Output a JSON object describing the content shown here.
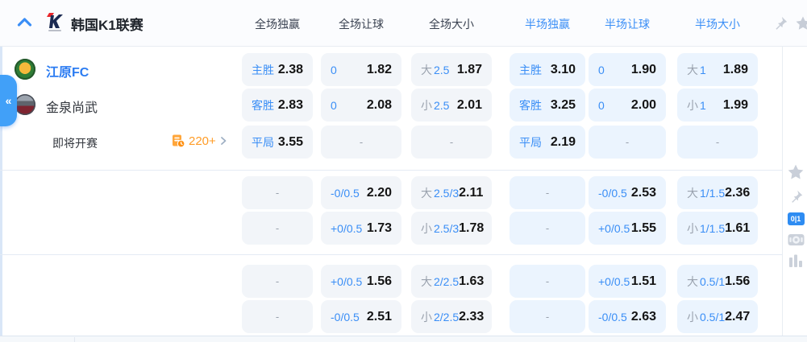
{
  "header": {
    "league_name": "韩国K1联赛",
    "columns": [
      "全场独赢",
      "全场让球",
      "全场大小",
      "半场独赢",
      "半场让球",
      "半场大小"
    ]
  },
  "teams": [
    {
      "name": "江原FC"
    },
    {
      "name": "金泉尚武"
    }
  ],
  "status": {
    "label": "即将开赛",
    "more_count": "220+"
  },
  "side_tab": {
    "glyph": "«"
  },
  "rail": {
    "score": "0|1"
  },
  "colors": {
    "accent_blue": "#3A8EF6",
    "team_blue": "#2B7CF2",
    "odds_black": "#141414",
    "muted_grey": "#9AA2AE",
    "orange": "#FF9C27",
    "cell_full_bg": "#F2F5F9",
    "cell_half_bg": "#EBF4FE"
  },
  "rows": [
    {
      "cells": [
        {
          "b": "主胜",
          "o": "2.38"
        },
        {
          "b": "0",
          "o": "1.82"
        },
        {
          "g": "大",
          "b": "2.5",
          "o": "1.87"
        },
        {
          "b": "主胜",
          "o": "3.10"
        },
        {
          "b": "0",
          "o": "1.90"
        },
        {
          "g": "大",
          "b": "1",
          "o": "1.89"
        }
      ]
    },
    {
      "cells": [
        {
          "b": "客胜",
          "o": "2.83"
        },
        {
          "b": "0",
          "o": "2.08"
        },
        {
          "g": "小",
          "b": "2.5",
          "o": "2.01"
        },
        {
          "b": "客胜",
          "o": "3.25"
        },
        {
          "b": "0",
          "o": "2.00"
        },
        {
          "g": "小",
          "b": "1",
          "o": "1.99"
        }
      ]
    },
    {
      "cells": [
        {
          "b": "平局",
          "o": "3.55"
        },
        {
          "d": "-"
        },
        {
          "d": "-"
        },
        {
          "b": "平局",
          "o": "2.19"
        },
        {
          "d": "-"
        },
        {
          "d": "-"
        }
      ]
    },
    {
      "cells": [
        {
          "d": "-"
        },
        {
          "b": "-0/0.5",
          "o": "2.20"
        },
        {
          "g": "大",
          "b": "2.5/3",
          "o": "2.11"
        },
        {
          "d": "-"
        },
        {
          "b": "-0/0.5",
          "o": "2.53"
        },
        {
          "g": "大",
          "b": "1/1.5",
          "o": "2.36"
        }
      ]
    },
    {
      "cells": [
        {
          "d": "-"
        },
        {
          "b": "+0/0.5",
          "o": "1.73"
        },
        {
          "g": "小",
          "b": "2.5/3",
          "o": "1.78"
        },
        {
          "d": "-"
        },
        {
          "b": "+0/0.5",
          "o": "1.55"
        },
        {
          "g": "小",
          "b": "1/1.5",
          "o": "1.61"
        }
      ]
    },
    {
      "cells": [
        {
          "d": "-"
        },
        {
          "b": "+0/0.5",
          "o": "1.56"
        },
        {
          "g": "大",
          "b": "2/2.5",
          "o": "1.63"
        },
        {
          "d": "-"
        },
        {
          "b": "+0/0.5",
          "o": "1.51"
        },
        {
          "g": "大",
          "b": "0.5/1",
          "o": "1.56"
        }
      ]
    },
    {
      "cells": [
        {
          "d": "-"
        },
        {
          "b": "-0/0.5",
          "o": "2.51"
        },
        {
          "g": "小",
          "b": "2/2.5",
          "o": "2.33"
        },
        {
          "d": "-"
        },
        {
          "b": "-0/0.5",
          "o": "2.63"
        },
        {
          "g": "小",
          "b": "0.5/1",
          "o": "2.47"
        }
      ]
    }
  ]
}
